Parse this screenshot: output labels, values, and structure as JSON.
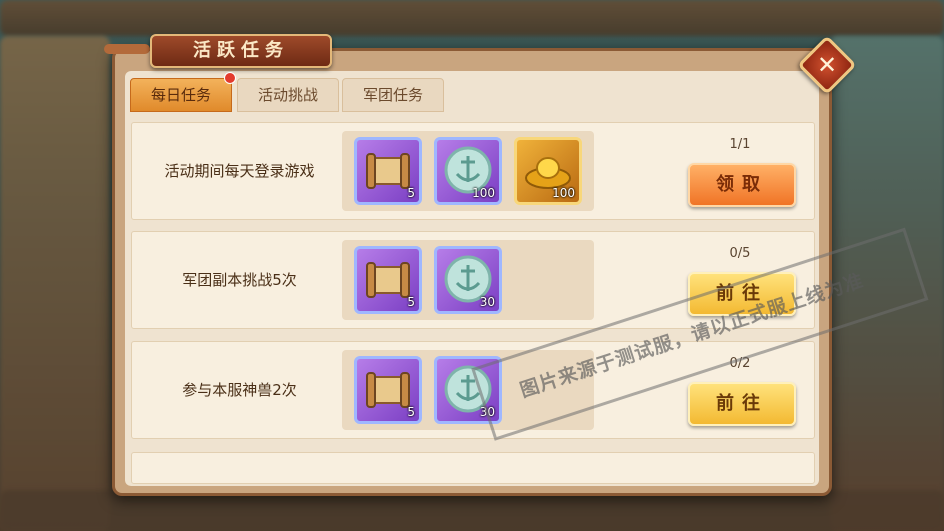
{
  "panel": {
    "title": "活跃任务",
    "close_label": "✕"
  },
  "tabs": [
    {
      "label": "每日任务",
      "active": true,
      "has_notification": true
    },
    {
      "label": "活动挑战",
      "active": false
    },
    {
      "label": "军团任务",
      "active": false
    }
  ],
  "tasks": [
    {
      "description": "活动期间每天登录游戏",
      "progress": "1/1",
      "button_label": "领取",
      "rewards": [
        {
          "icon": "scroll-icon",
          "count": "5"
        },
        {
          "icon": "anchor-coin-icon",
          "count": "100"
        },
        {
          "icon": "gold-ingot-icon",
          "count": "100"
        }
      ]
    },
    {
      "description": "军团副本挑战5次",
      "progress": "0/5",
      "button_label": "前往",
      "rewards": [
        {
          "icon": "scroll-icon",
          "count": "5"
        },
        {
          "icon": "anchor-coin-icon",
          "count": "30"
        }
      ]
    },
    {
      "description": "参与本服神兽2次",
      "progress": "0/2",
      "button_label": "前往",
      "rewards": [
        {
          "icon": "scroll-icon",
          "count": "5"
        },
        {
          "icon": "anchor-coin-icon",
          "count": "30"
        }
      ]
    }
  ],
  "watermark": {
    "line1": "图片来源于测试服，请以正式服上线为准"
  },
  "colors": {
    "claim_button": "#f07426",
    "go_button": "#f3b932",
    "tab_active": "#e08a2b",
    "notification_dot": "#e33b2d"
  }
}
